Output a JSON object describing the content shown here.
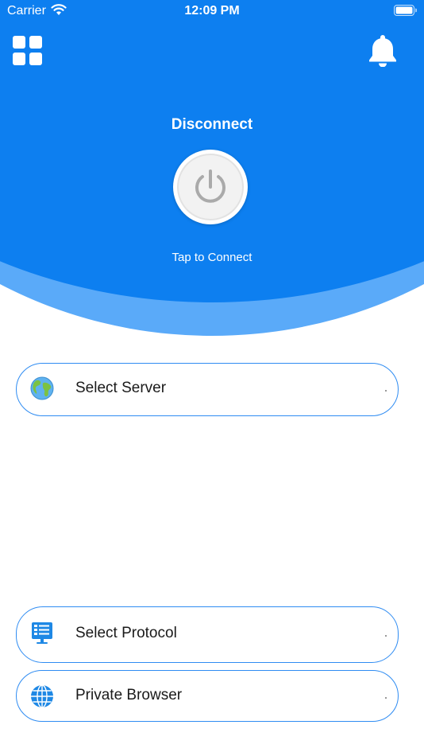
{
  "status_bar": {
    "carrier": "Carrier",
    "time": "12:09 PM",
    "wifi_icon": "wifi-icon",
    "battery_icon": "battery-full-icon"
  },
  "header": {
    "menu_icon": "grid-menu-icon",
    "notification_icon": "bell-icon",
    "primary_color": "#0d7ff0",
    "secondary_color": "#5aaaf9"
  },
  "connection": {
    "status": "Disconnect",
    "hint": "Tap to Connect",
    "power_icon": "power-icon"
  },
  "options": {
    "server": {
      "label": "Select Server",
      "icon": "globe-earth-icon"
    },
    "protocol": {
      "label": "Select Protocol",
      "icon": "protocol-settings-icon"
    },
    "browser": {
      "label": "Private Browser",
      "icon": "globe-web-icon"
    }
  }
}
